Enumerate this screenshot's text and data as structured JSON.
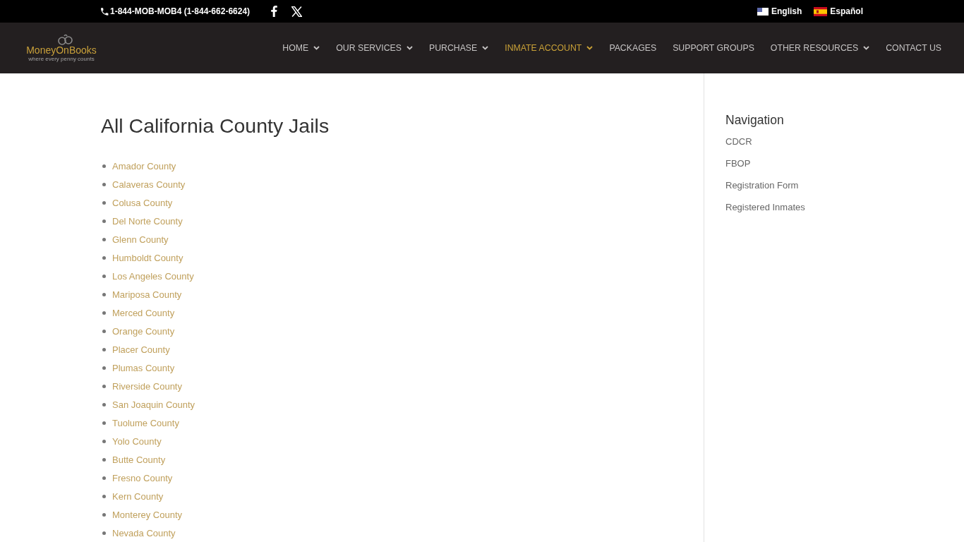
{
  "top_bar": {
    "phone": "1-844-MOB-MOB4 (1-844-662-6624)",
    "languages": [
      {
        "label": "English",
        "kind": "us"
      },
      {
        "label": "Español",
        "kind": "es"
      }
    ]
  },
  "header": {
    "logo": {
      "wordmark": "MoneyOnBooks",
      "tagline": "where every penny counts"
    },
    "nav": [
      {
        "label": "HOME",
        "has_dropdown": true,
        "selected": false
      },
      {
        "label": "OUR SERVICES",
        "has_dropdown": true,
        "selected": false
      },
      {
        "label": "PURCHASE",
        "has_dropdown": true,
        "selected": false
      },
      {
        "label": "INMATE ACCOUNT",
        "has_dropdown": true,
        "selected": true
      },
      {
        "label": "PACKAGES",
        "has_dropdown": false,
        "selected": false
      },
      {
        "label": "SUPPORT GROUPS",
        "has_dropdown": false,
        "selected": false
      },
      {
        "label": "OTHER RESOURCES",
        "has_dropdown": true,
        "selected": false
      },
      {
        "label": "CONTACT US",
        "has_dropdown": false,
        "selected": false
      }
    ]
  },
  "page": {
    "title": "All California County Jails",
    "counties": [
      "Amador County",
      "Calaveras County",
      "Colusa County",
      "Del Norte County",
      "Glenn County",
      "Humboldt County",
      "Los Angeles County",
      "Mariposa County",
      "Merced County",
      "Orange County",
      "Placer County",
      "Plumas County",
      "Riverside County",
      "San Joaquin County",
      "Tuolume County",
      "Yolo County",
      "Butte County",
      "Fresno County",
      "Kern County",
      "Monterey County",
      "Nevada County"
    ]
  },
  "sidebar": {
    "title": "Navigation",
    "links": [
      "CDCR",
      "FBOP",
      "Registration Form",
      "Registered Inmates"
    ]
  }
}
